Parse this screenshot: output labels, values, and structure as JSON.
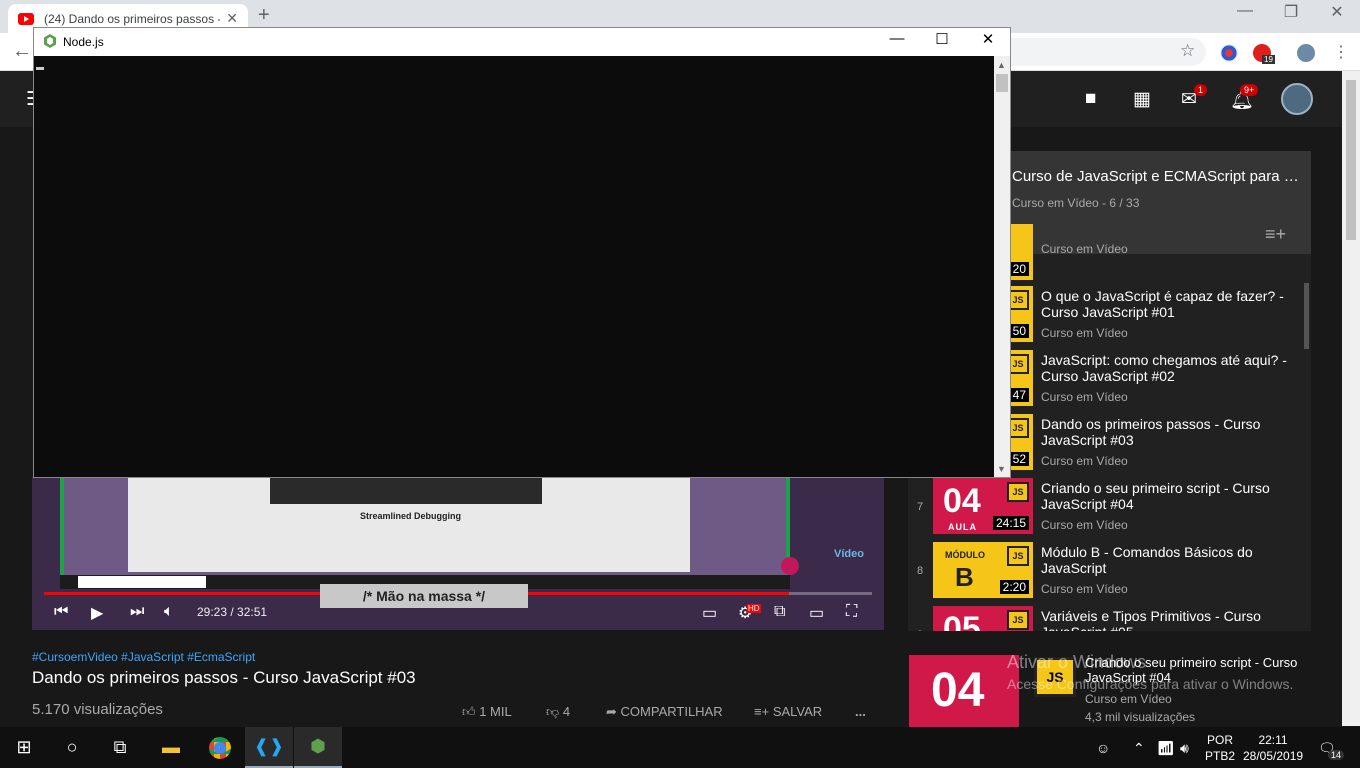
{
  "browser": {
    "tab_title": "(24) Dando os primeiros passos -",
    "tab_close": "✕",
    "new_tab": "+",
    "ext_badge": "19"
  },
  "youtube_header": {
    "chat_badge": "1",
    "notif_badge": "9+"
  },
  "playlist": {
    "title": "Curso de JavaScript e ECMAScript para Iniciantes",
    "subtitle": "Curso em Vídeo - 6 / 33",
    "items": [
      {
        "num": "",
        "title": "",
        "channel": "Curso em Vídeo",
        "duration": "20"
      },
      {
        "num": "",
        "title": "O que o JavaScript é capaz de fazer? - Curso JavaScript #01",
        "channel": "Curso em Vídeo",
        "duration": "50"
      },
      {
        "num": "",
        "title": "JavaScript: como chegamos até aqui? - Curso JavaScript #02",
        "channel": "Curso em Vídeo",
        "duration": "47"
      },
      {
        "num": "",
        "title": "Dando os primeiros passos - Curso JavaScript #03",
        "channel": "Curso em Vídeo",
        "duration": "52"
      },
      {
        "num": "7",
        "title": "Criando o seu primeiro script - Curso JavaScript #04",
        "channel": "Curso em Vídeo",
        "duration": "24:15",
        "big": "04",
        "aula": "AULA"
      },
      {
        "num": "8",
        "title": "Módulo B - Comandos Básicos do JavaScript",
        "channel": "Curso em Vídeo",
        "duration": "2:20",
        "mod": "MÓDULO",
        "modb": "B"
      },
      {
        "num": "9",
        "title": "Variáveis e Tipos Primitivos - Curso JavaScript #05",
        "channel": "Curso em Vídeo",
        "duration": "",
        "big": "05"
      }
    ]
  },
  "video": {
    "overlay_text": "/* Mão na massa */",
    "debug_text": "Streamlined Debugging",
    "logo_text": "Vídeo",
    "current_time": "29:23",
    "total_time": "32:51",
    "time_sep": " / ",
    "progress": 0.9,
    "hd_badge": "HD"
  },
  "info": {
    "tags": "#CursoemVideo #JavaScript #EcmaScript",
    "title": "Dando os primeiros passos - Curso JavaScript #03",
    "views": "5.170 visualizações",
    "likes": "1 MIL",
    "dislikes": "4",
    "share": "COMPARTILHAR",
    "save": "SALVAR",
    "more": "..."
  },
  "up_next": {
    "title": "Criando o seu primeiro script - Curso JavaScript #04",
    "channel": "Curso em Vídeo",
    "views": "4,3 mil visualizações",
    "thumb_text": "04",
    "js_text": "JS"
  },
  "activate_windows": {
    "line1": "Ativar o Windows",
    "line2": "Acesse Configurações para ativar o Windows."
  },
  "node_window": {
    "title": "Node.js",
    "minimize": "—",
    "maximize": "☐",
    "close": "✕"
  },
  "taskbar": {
    "lang_top": "POR",
    "lang_bottom": "PTB2",
    "time": "22:11",
    "date": "28/05/2019",
    "notif_count": "14"
  }
}
